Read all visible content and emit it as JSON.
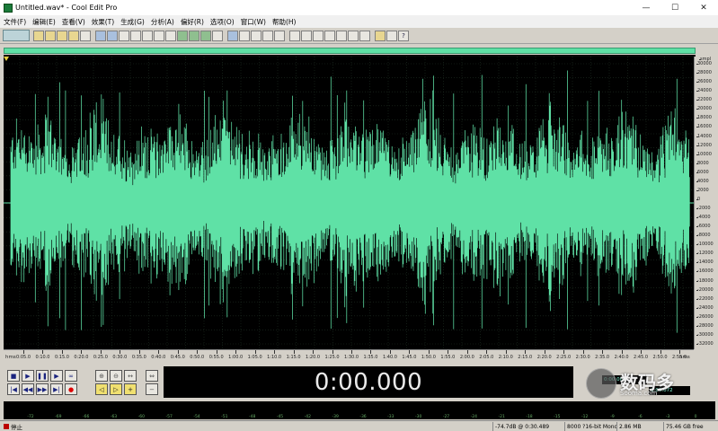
{
  "window": {
    "title": "Untitled.wav* - Cool Edit Pro",
    "minimize": "—",
    "maximize": "☐",
    "close": "✕"
  },
  "menu": [
    "文件(F)",
    "编辑(E)",
    "查看(V)",
    "效果(T)",
    "生成(G)",
    "分析(A)",
    "偏好(R)",
    "选项(O)",
    "窗口(W)",
    "帮助(H)"
  ],
  "waveform": {
    "color": "#5fe1a6",
    "background": "#000000",
    "vertical_unit": "smpl",
    "vertical_ticks": [
      "30000",
      "28000",
      "26000",
      "24000",
      "22000",
      "20000",
      "18000",
      "16000",
      "14000",
      "12000",
      "10000",
      "8000",
      "6000",
      "4000",
      "2000",
      "0",
      "-2000",
      "-4000",
      "-6000",
      "-8000",
      "-10000",
      "-12000",
      "-14000",
      "-16000",
      "-18000",
      "-20000",
      "-22000",
      "-24000",
      "-26000",
      "-28000",
      "-30000",
      "-32000"
    ],
    "time_unit": "hms",
    "time_ticks": [
      "0:05.0",
      "0:10.0",
      "0:15.0",
      "0:20.0",
      "0:25.0",
      "0:30.0",
      "0:35.0",
      "0:40.0",
      "0:45.0",
      "0:50.0",
      "0:55.0",
      "1:00.0",
      "1:05.0",
      "1:10.0",
      "1:15.0",
      "1:20.0",
      "1:25.0",
      "1:30.0",
      "1:35.0",
      "1:40.0",
      "1:45.0",
      "1:50.0",
      "1:55.0",
      "2:00.0",
      "2:05.0",
      "2:10.0",
      "2:15.0",
      "2:20.0",
      "2:25.0",
      "2:30.0",
      "2:35.0",
      "2:40.0",
      "2:45.0",
      "2:50.0",
      "2:55.0"
    ]
  },
  "transport": {
    "stop": "■",
    "play": "▶",
    "pause": "❚❚",
    "play_to_end": "▶",
    "loop": "∞",
    "go_start": "|◀",
    "rewind": "◀◀",
    "fast_forward": "▶▶",
    "go_end": "▶|",
    "record": "●"
  },
  "zoom": {
    "zoom_in_h": "⊕",
    "zoom_out_h": "⊖",
    "zoom_full": "↔",
    "zoom_sel": "⇔",
    "zoom_in_v": "+",
    "zoom_out_v": "−",
    "zoom_left": "◁",
    "zoom_right": "▷"
  },
  "time_display": "0:00.000",
  "selection": {
    "begin": "0:00.000",
    "end": "3:00.072"
  },
  "watermark": {
    "text": "数码多",
    "url": "Sooma.com"
  },
  "meter_ticks": [
    "-72",
    "-69",
    "-66",
    "-63",
    "-60",
    "-57",
    "-54",
    "-51",
    "-48",
    "-45",
    "-42",
    "-39",
    "-36",
    "-33",
    "-30",
    "-27",
    "-24",
    "-21",
    "-18",
    "-15",
    "-12",
    "-9",
    "-6",
    "-3",
    "0"
  ],
  "status": {
    "state": "停止",
    "cursor_level": "-74.7dB @ 0:30.489",
    "format": "8000 ?16-bit Mono",
    "size": "2.86 MB",
    "free": "75.46 GB free"
  }
}
